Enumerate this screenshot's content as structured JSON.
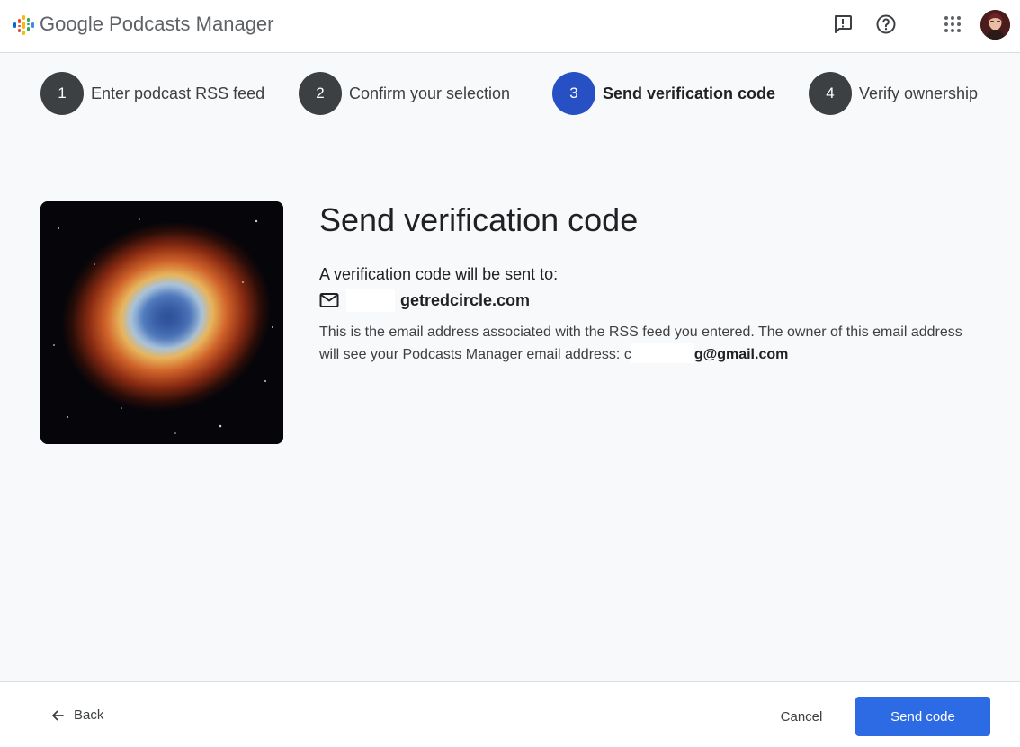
{
  "app": {
    "title": "Google Podcasts Manager"
  },
  "header": {
    "icons": [
      "feedback-icon",
      "help-icon",
      "apps-grid-icon"
    ],
    "avatar_icon": "user-avatar"
  },
  "stepper": {
    "steps": [
      {
        "number": "1",
        "label": "Enter podcast RSS feed",
        "active": false
      },
      {
        "number": "2",
        "label": "Confirm your selection",
        "active": false
      },
      {
        "number": "3",
        "label": "Send verification code",
        "active": true
      },
      {
        "number": "4",
        "label": "Verify ownership",
        "active": false
      }
    ]
  },
  "main": {
    "artwork_icon": "podcast-artwork-nebula",
    "heading": "Send verification code",
    "sent_to_label": "A verification code will be sent to:",
    "email_icon": "mail-icon",
    "email_visible": "getredcircle.com",
    "description": "This is the email address associated with the RSS feed you entered. The owner of this email address will see your Podcasts Manager email address: ",
    "manager_email_prefix": "c",
    "manager_email_visible": "g@gmail.com"
  },
  "footer": {
    "back_label": "Back",
    "cancel_label": "Cancel",
    "send_label": "Send code"
  },
  "colors": {
    "accent": "#2d6be4",
    "active_step": "#2750c4",
    "step_inactive": "#3c4043",
    "background": "#f8f9fb"
  }
}
